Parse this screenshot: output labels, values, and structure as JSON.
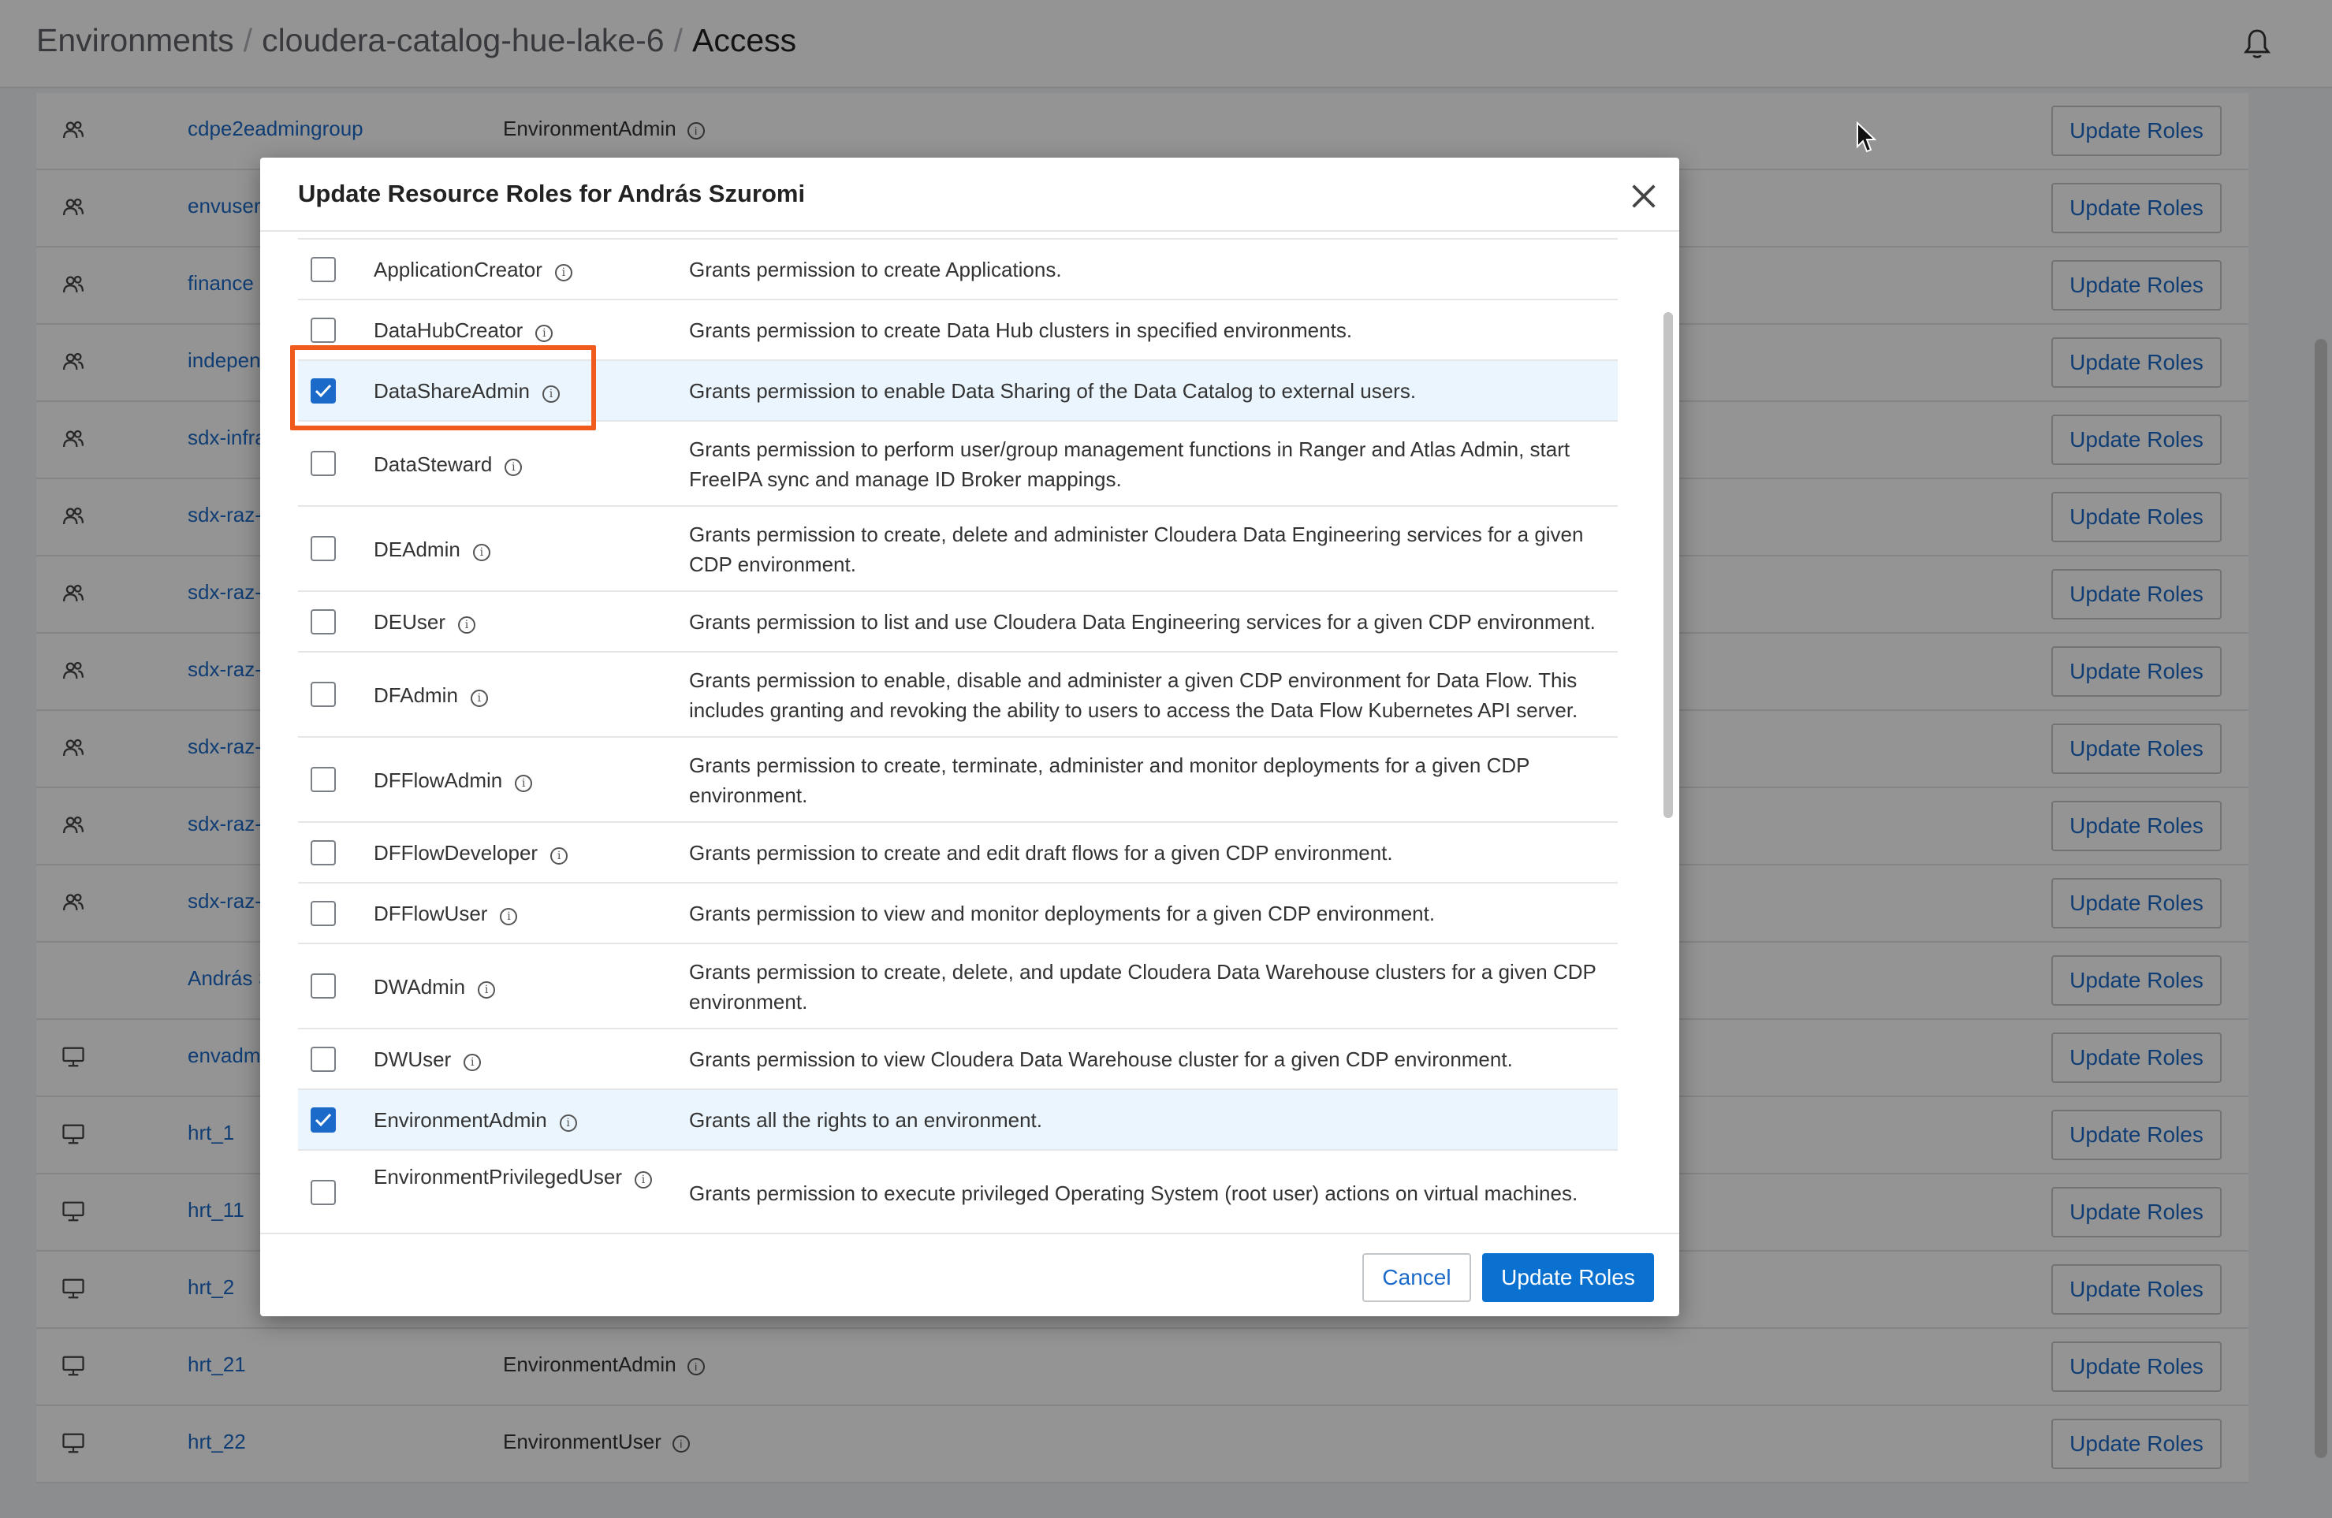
{
  "header": {
    "breadcrumb": [
      "Environments",
      "cloudera-catalog-hue-lake-6",
      "Access"
    ],
    "separator": "/"
  },
  "access_list": {
    "update_label": "Update Roles",
    "rows": [
      {
        "icon": "group-icon",
        "name": "cdpe2eadmingroup",
        "role": "EnvironmentAdmin"
      },
      {
        "icon": "group-icon",
        "name": "envuser",
        "role": ""
      },
      {
        "icon": "group-icon",
        "name": "finance",
        "role": ""
      },
      {
        "icon": "group-icon",
        "name": "indepen",
        "role": ""
      },
      {
        "icon": "group-icon",
        "name": "sdx-infra",
        "role": ""
      },
      {
        "icon": "group-icon",
        "name": "sdx-raz-",
        "role": ""
      },
      {
        "icon": "group-icon",
        "name": "sdx-raz-",
        "role": ""
      },
      {
        "icon": "group-icon",
        "name": "sdx-raz-",
        "role": ""
      },
      {
        "icon": "group-icon",
        "name": "sdx-raz-",
        "role": ""
      },
      {
        "icon": "group-icon",
        "name": "sdx-raz-",
        "role": ""
      },
      {
        "icon": "group-icon",
        "name": "sdx-raz-",
        "role": ""
      },
      {
        "icon": "none",
        "name": "András S",
        "role": ""
      },
      {
        "icon": "machine-icon",
        "name": "envadm",
        "role": ""
      },
      {
        "icon": "machine-icon",
        "name": "hrt_1",
        "role": ""
      },
      {
        "icon": "machine-icon",
        "name": "hrt_11",
        "role": ""
      },
      {
        "icon": "machine-icon",
        "name": "hrt_2",
        "role": ""
      },
      {
        "icon": "machine-icon",
        "name": "hrt_21",
        "role": "EnvironmentAdmin"
      },
      {
        "icon": "machine-icon",
        "name": "hrt_22",
        "role": "EnvironmentUser"
      }
    ]
  },
  "modal": {
    "title": "Update Resource Roles for András Szuromi",
    "cancel_label": "Cancel",
    "submit_label": "Update Roles",
    "roles": [
      {
        "name": "ApplicationCreator",
        "checked": false,
        "description": "Grants permission to create Applications."
      },
      {
        "name": "DataHubCreator",
        "checked": false,
        "description": "Grants permission to create Data Hub clusters in specified environments."
      },
      {
        "name": "DataShareAdmin",
        "checked": true,
        "description": "Grants permission to enable Data Sharing of the Data Catalog to external users."
      },
      {
        "name": "DataSteward",
        "checked": false,
        "description": "Grants permission to perform user/group management functions in Ranger and Atlas Admin, start FreeIPA sync and manage ID Broker mappings."
      },
      {
        "name": "DEAdmin",
        "checked": false,
        "description": "Grants permission to create, delete and administer Cloudera Data Engineering services for a given CDP environment."
      },
      {
        "name": "DEUser",
        "checked": false,
        "description": "Grants permission to list and use Cloudera Data Engineering services for a given CDP environment."
      },
      {
        "name": "DFAdmin",
        "checked": false,
        "description": "Grants permission to enable, disable and administer a given CDP environment for Data Flow. This includes granting and revoking the ability to users to access the Data Flow Kubernetes API server."
      },
      {
        "name": "DFFlowAdmin",
        "checked": false,
        "description": "Grants permission to create, terminate, administer and monitor deployments for a given CDP environment."
      },
      {
        "name": "DFFlowDeveloper",
        "checked": false,
        "description": "Grants permission to create and edit draft flows for a given CDP environment."
      },
      {
        "name": "DFFlowUser",
        "checked": false,
        "description": "Grants permission to view and monitor deployments for a given CDP environment."
      },
      {
        "name": "DWAdmin",
        "checked": false,
        "description": "Grants permission to create, delete, and update Cloudera Data Warehouse clusters for a given CDP environment."
      },
      {
        "name": "DWUser",
        "checked": false,
        "description": "Grants permission to view Cloudera Data Warehouse cluster for a given CDP environment."
      },
      {
        "name": "EnvironmentAdmin",
        "checked": true,
        "description": "Grants all the rights to an environment."
      },
      {
        "name": "EnvironmentPrivilegedUser",
        "checked": false,
        "description": "Grants permission to execute privileged Operating System (root user) actions on virtual machines."
      }
    ]
  },
  "colors": {
    "link": "#1b6ac9",
    "primary": "#0a71d0",
    "selected_row": "#eaf5fd",
    "highlight": "#f05a1d"
  }
}
